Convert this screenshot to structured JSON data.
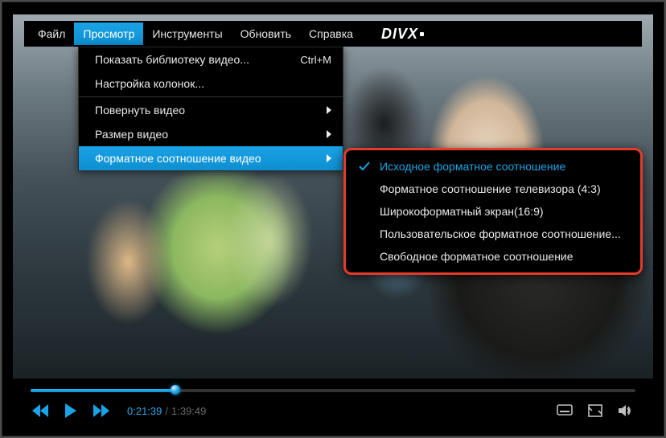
{
  "logo": {
    "text": "DIVX"
  },
  "menubar": {
    "file": "Файл",
    "view": "Просмотр",
    "tools": "Инструменты",
    "update": "Обновить",
    "help": "Справка",
    "active": "view"
  },
  "dropdown": {
    "show_library": "Показать библиотеку видео...",
    "show_library_shortcut": "Ctrl+M",
    "column_settings": "Настройка колонок...",
    "rotate_video": "Повернуть видео",
    "video_size": "Размер видео",
    "aspect_ratio": "Форматное соотношение видео"
  },
  "submenu": {
    "original": "Исходное форматное соотношение",
    "tv_4_3": "Форматное соотношение телевизора (4:3)",
    "wide_16_9": "Широкоформатный экран(16:9)",
    "custom": "Пользовательское форматное соотношение...",
    "free": "Свободное форматное соотношение",
    "selected_index": 0
  },
  "playback": {
    "current": "0:21:39",
    "total": "1:39:49",
    "progress": 0.24
  },
  "colors": {
    "accent": "#1aa3e6",
    "highlight_border": "#e63a2a"
  }
}
